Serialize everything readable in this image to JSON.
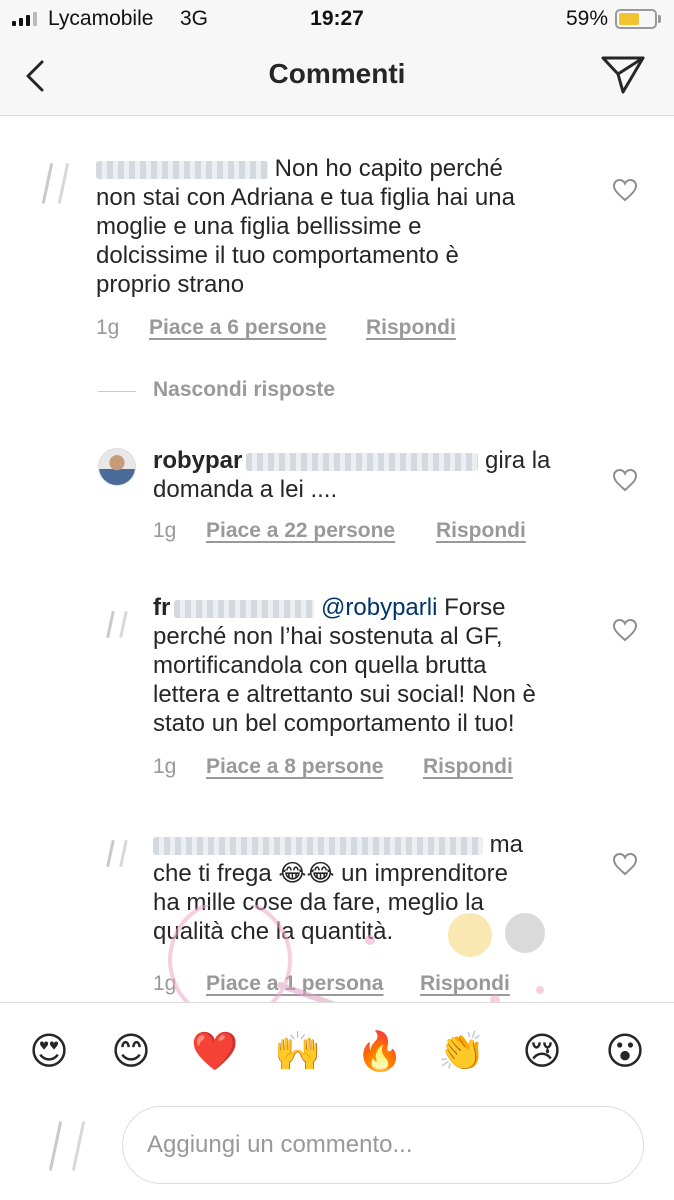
{
  "status_bar": {
    "carrier": "Lycamobile",
    "network": "3G",
    "time": "19:27",
    "battery_percent": "59%",
    "battery_level": 0.59,
    "signal_bars_active": 3
  },
  "nav": {
    "title": "Commenti",
    "back_icon": "chevron-left-icon",
    "send_icon": "paper-plane-icon"
  },
  "comments": [
    {
      "text_lines": [
        "Non ho capito perché",
        "non stai con Adriana e tua figlia hai una",
        "moglie e una figlia bellissime e",
        "dolcissime il tuo comportamento è",
        "proprio strano"
      ],
      "time": "1g",
      "likes": "Piace a 6 persone",
      "reply": "Rispondi"
    }
  ],
  "hide_replies": "Nascondi risposte",
  "replies": [
    {
      "user": "robypar",
      "text_line1_tail": "gira la",
      "text_lines": [
        "domanda a lei ...."
      ],
      "time": "1g",
      "likes": "Piace a 22 persone",
      "reply": "Rispondi"
    },
    {
      "user": "fr",
      "mention": "@robyparli",
      "text_line1_tail": "Forse",
      "text_lines": [
        "perché non l’hai sostenuta al GF,",
        "mortificandola con quella brutta",
        "lettera e altrettanto sui social! Non è",
        "stato un bel comportamento il tuo!"
      ],
      "time": "1g",
      "likes": "Piace a 8 persone",
      "reply": "Rispondi"
    },
    {
      "text_line1_tail": "ma",
      "text_lines": [
        "che ti frega 😂😂 un imprenditore",
        "ha mille cose da fare, meglio la",
        "qualità che la quantità."
      ],
      "time": "1g",
      "likes": "Piace a 1 persona",
      "reply": "Rispondi"
    }
  ],
  "emoji_bar": [
    "😍",
    "😊",
    "❤️",
    "🙌",
    "🔥",
    "👏",
    "😢",
    "😮"
  ],
  "composer": {
    "placeholder": "Aggiungi un commento..."
  },
  "colors": {
    "text": "#262626",
    "meta": "#999999",
    "mention": "#003569",
    "battery": "#f2c230"
  }
}
